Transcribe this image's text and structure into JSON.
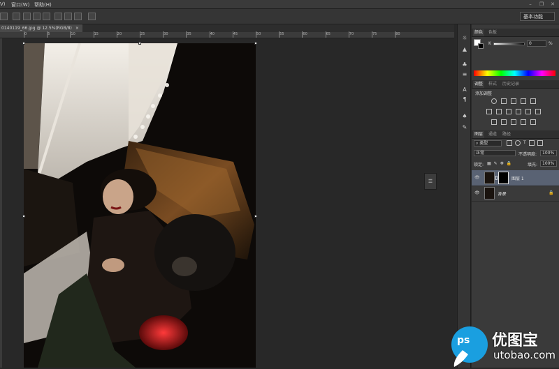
{
  "menubar": {
    "items": [
      "V)",
      "窗口(W)",
      "帮助(H)"
    ],
    "window_controls": [
      "–",
      "❐",
      "✕"
    ]
  },
  "options_bar": {
    "workspace_label": "基本功能"
  },
  "document": {
    "tab_title": "0140119_66.jpg @ 12.5%(RGB/8)",
    "tab_close": "×"
  },
  "ruler": {
    "labels": [
      "0",
      "5",
      "10",
      "15",
      "20",
      "25",
      "30",
      "35",
      "40",
      "45",
      "50",
      "55",
      "60",
      "65",
      "70",
      "75",
      "80"
    ]
  },
  "color_panel": {
    "tabs": [
      "颜色",
      "色板"
    ],
    "slider_label": "K",
    "value": "0",
    "unit": "%"
  },
  "adjust_panel": {
    "tabs": [
      "调整",
      "样式",
      "历史记录"
    ],
    "title": "添加调整"
  },
  "layers_panel": {
    "tabs": [
      "图层",
      "通道",
      "路径"
    ],
    "filter_label": "类型",
    "blend_mode": "正常",
    "opacity_label": "不透明度:",
    "opacity_value": "100%",
    "lock_label": "锁定:",
    "fill_label": "填充:",
    "fill_value": "100%",
    "layers": [
      {
        "name": "图层 1",
        "selected": true
      },
      {
        "name": "背景",
        "selected": false
      }
    ]
  },
  "watermark": {
    "brand_cn": "优图宝",
    "brand_en": "utobao.com",
    "prefix": "ps"
  },
  "colors": {
    "selected_layer_bg": "#596273",
    "watermark_blue": "#1a9fe0"
  }
}
